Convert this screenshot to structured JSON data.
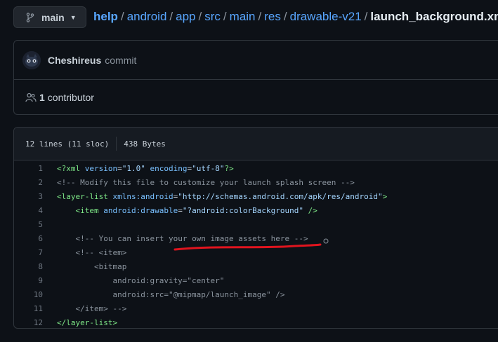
{
  "branch": {
    "label": "main"
  },
  "breadcrumb": {
    "root": "help",
    "parts": [
      "android",
      "app",
      "src",
      "main",
      "res",
      "drawable-v21"
    ],
    "file": "launch_background.xml"
  },
  "commit": {
    "author": "Cheshireus",
    "message": "commit"
  },
  "contributors": {
    "count": "1",
    "label": "contributor"
  },
  "file_info": {
    "lines": "12 lines (11 sloc)",
    "size": "438 Bytes"
  },
  "code": {
    "lines": [
      {
        "n": "1",
        "t": "<?xml version=\"1.0\" encoding=\"utf-8\"?>"
      },
      {
        "n": "2",
        "t": "<!-- Modify this file to customize your launch splash screen -->"
      },
      {
        "n": "3",
        "t": "<layer-list xmlns:android=\"http://schemas.android.com/apk/res/android\">"
      },
      {
        "n": "4",
        "t": "    <item android:drawable=\"?android:colorBackground\" />"
      },
      {
        "n": "5",
        "t": ""
      },
      {
        "n": "6",
        "t": "    <!-- You can insert your own image assets here -->"
      },
      {
        "n": "7",
        "t": "    <!-- <item>"
      },
      {
        "n": "8",
        "t": "        <bitmap"
      },
      {
        "n": "9",
        "t": "            android:gravity=\"center\""
      },
      {
        "n": "10",
        "t": "            android:src=\"@mipmap/launch_image\" />"
      },
      {
        "n": "11",
        "t": "    </item> -->"
      },
      {
        "n": "12",
        "t": "</layer-list>"
      }
    ]
  },
  "colors": {
    "background": "#0d1117",
    "link": "#58a6ff",
    "annotation": "#e0141e"
  },
  "icons": {
    "branch": "git-branch-icon",
    "people": "people-icon",
    "caret": "triangle-down-icon"
  }
}
